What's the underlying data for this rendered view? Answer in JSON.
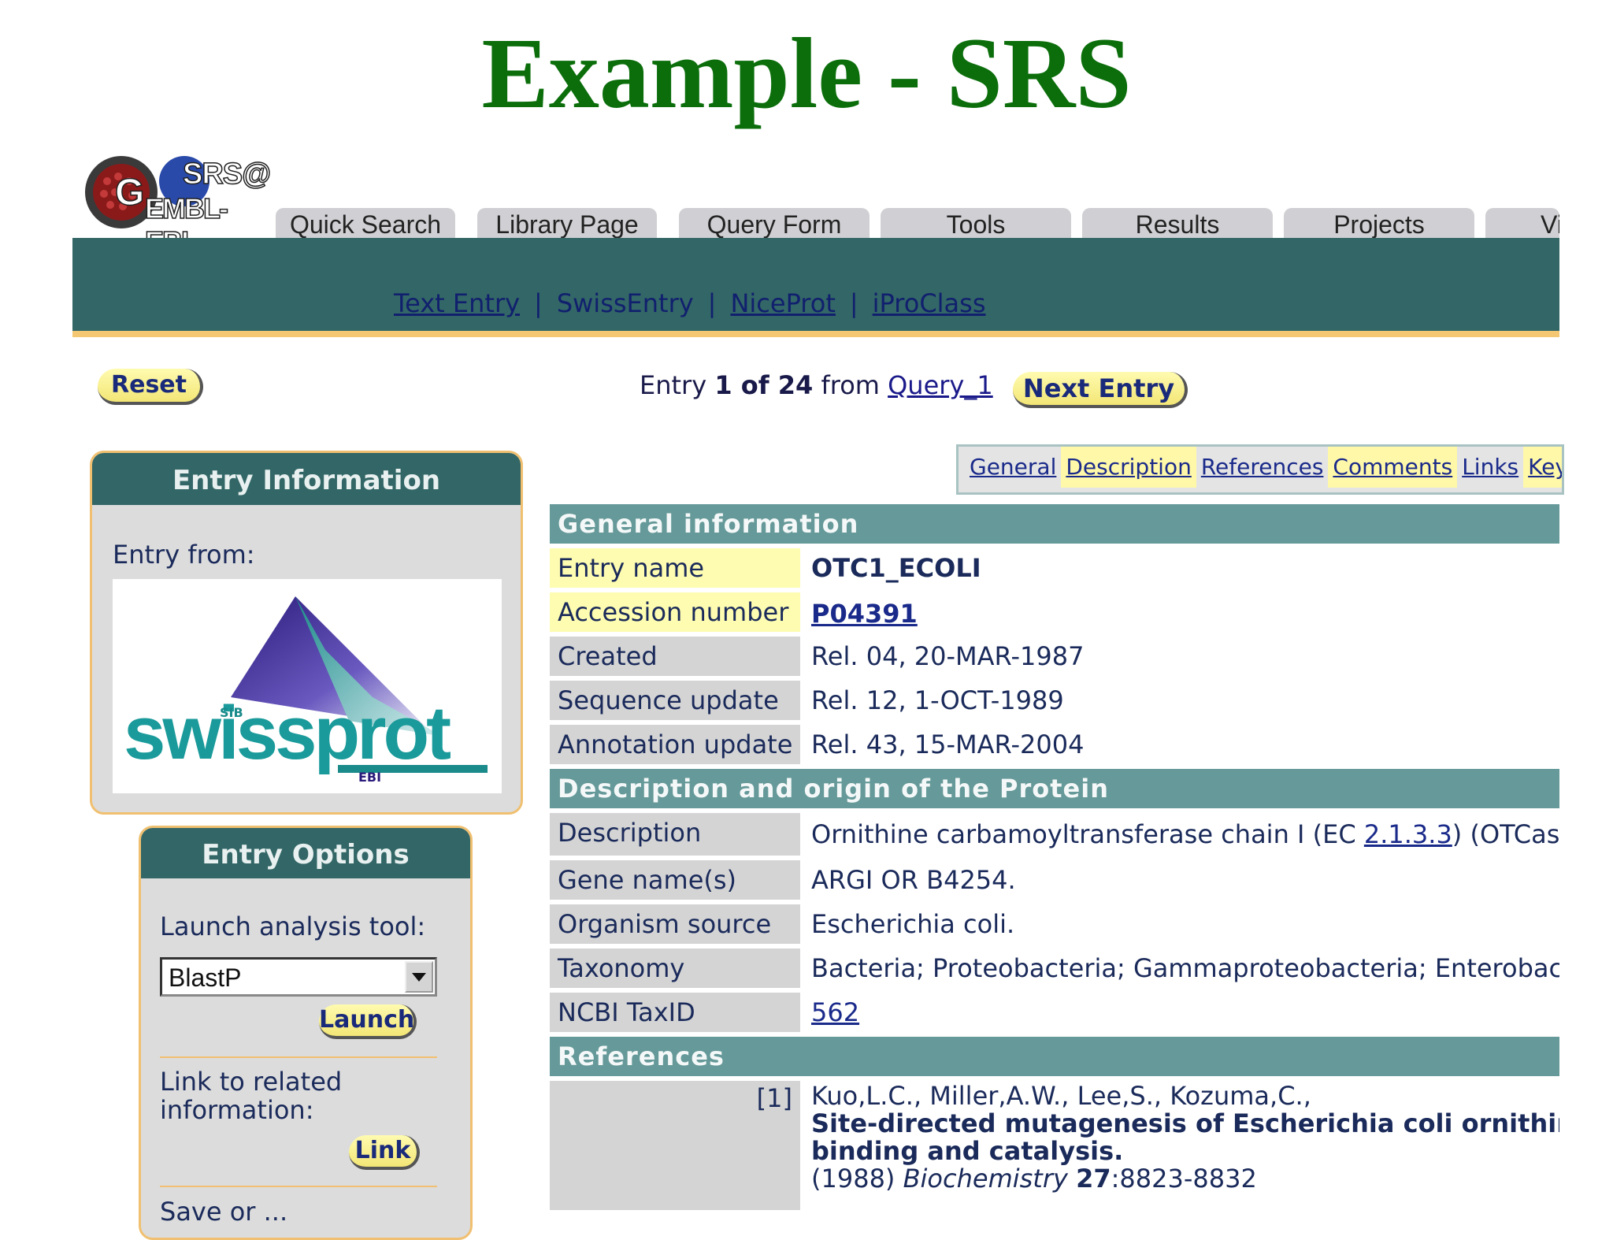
{
  "slide_title": "Example - SRS",
  "logo": {
    "line1": "SRS@",
    "line2": "EMBL-EBI"
  },
  "tabs": [
    "Quick Search",
    "Library Page",
    "Query Form",
    "Tools",
    "Results",
    "Projects",
    "View"
  ],
  "subnav": {
    "items": [
      "Text Entry",
      "SwissEntry",
      "NiceProt",
      "iProClass"
    ]
  },
  "buttons": {
    "reset": "Reset",
    "next_entry": "Next Entry",
    "launch": "Launch",
    "link": "Link"
  },
  "entry_nav": {
    "prefix": "Entry ",
    "current": "1 of 24",
    "middle": " from ",
    "query": "Query_1"
  },
  "entry_info": {
    "title": "Entry Information",
    "entry_from_label": "Entry from:",
    "logo_text": "swissprot",
    "logo_sib": "SIB",
    "logo_ebi": "EBI"
  },
  "entry_options": {
    "title": "Entry Options",
    "launch_label": "Launch analysis tool:",
    "tool_selected": "BlastP",
    "link_label_1": "Link to related",
    "link_label_2": "information:",
    "more_label": "Save or ..."
  },
  "section_tabs": [
    "General",
    "Description",
    "References",
    "Comments",
    "Links",
    "Keywords"
  ],
  "general": {
    "title": "General information",
    "rows": [
      {
        "label": "Entry name",
        "value": "OTC1_ECOLI"
      },
      {
        "label": "Accession number",
        "value": "P04391"
      },
      {
        "label": "Created",
        "value": "Rel. 04, 20-MAR-1987"
      },
      {
        "label": "Sequence update",
        "value": "Rel. 12, 1-OCT-1989"
      },
      {
        "label": "Annotation update",
        "value": "Rel. 43, 15-MAR-2004"
      }
    ]
  },
  "description": {
    "title": "Description and origin of the Protein",
    "desc_label": "Description",
    "desc_prefix": "Ornithine carbamoyltransferase chain I (EC ",
    "desc_ec": "2.1.3.3",
    "desc_suffix": ") (OTCase",
    "gene_label": "Gene name(s)",
    "gene_value": "ARGI OR B4254.",
    "org_label": "Organism source",
    "org_value": "Escherichia coli.",
    "tax_label": "Taxonomy",
    "tax_value": "Bacteria; Proteobacteria; Gammaproteobacteria; Enterobacteriales",
    "ncbi_label": "NCBI TaxID",
    "ncbi_value": "562"
  },
  "references": {
    "title": "References",
    "index": "[1]",
    "authors": "Kuo,L.C., Miller,A.W., Lee,S., Kozuma,C.,",
    "title_line1": "Site-directed mutagenesis of Escherichia coli ornithine transcarbamoylase: role of",
    "title_line2": "binding and catalysis.",
    "year": "(1988)",
    "journal": "Biochemistry",
    "volume": "27",
    "pages": ":8823-8832"
  }
}
